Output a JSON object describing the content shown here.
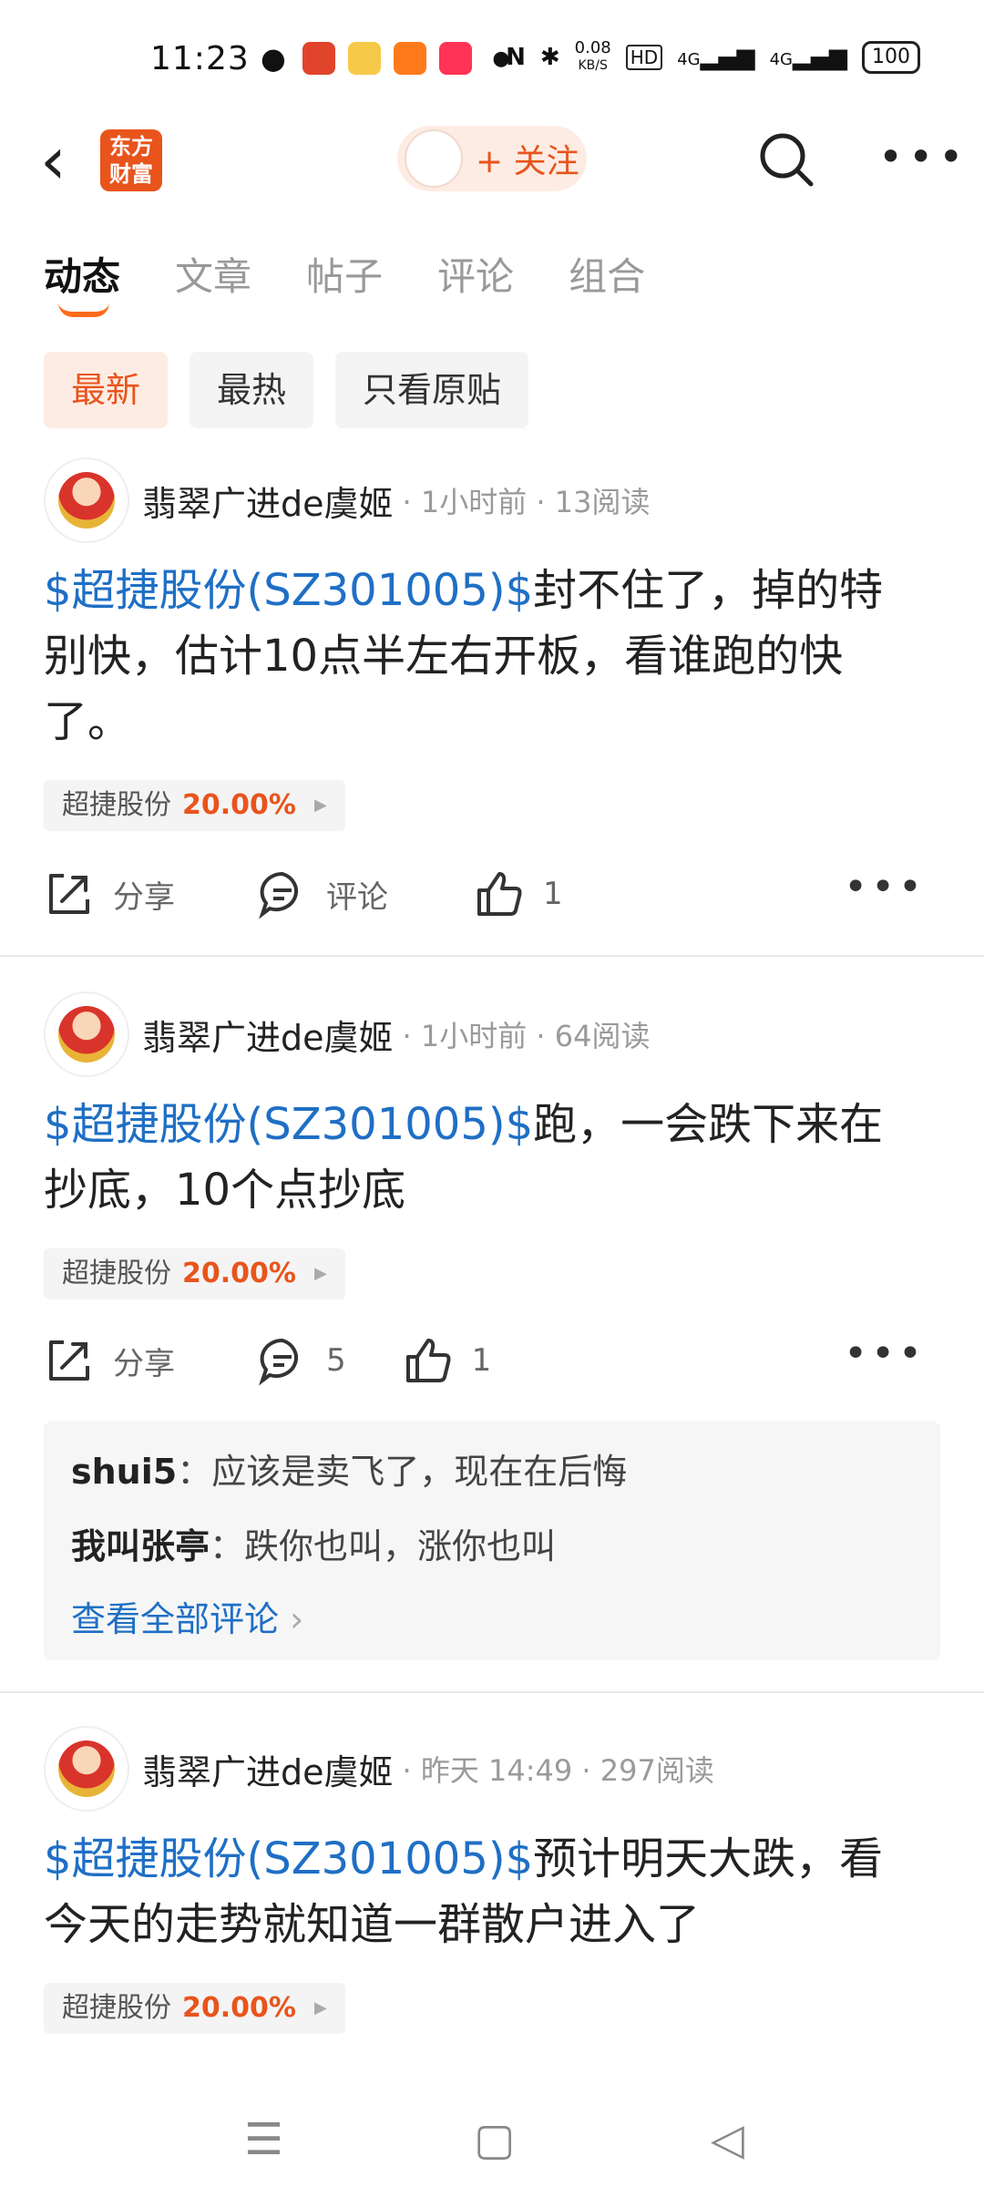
{
  "status_bar": {
    "time": "11:23",
    "net_speed": "0.08",
    "net_unit": "KB/S",
    "hd": "HD",
    "sig1": "4G",
    "sig2": "4G",
    "battery": "100"
  },
  "nav": {
    "app_logo_top": "东方",
    "app_logo_bottom": "财富",
    "follow_label": "+ 关注"
  },
  "tabs": [
    "动态",
    "文章",
    "帖子",
    "评论",
    "组合"
  ],
  "filters": [
    "最新",
    "最热",
    "只看原贴"
  ],
  "posts": [
    {
      "author": "翡翠广进de虞姬",
      "meta": "· 1小时前 · 13阅读",
      "tag": "$超捷股份(SZ301005)$",
      "text": "封不住了，掉的特别快，估计10点半左右开板，看谁跑的快了。",
      "stock_name": "超捷股份",
      "stock_change": "20.00%",
      "share_label": "分享",
      "comment_label": "评论",
      "like_count": "1"
    },
    {
      "author": "翡翠广进de虞姬",
      "meta": "· 1小时前 · 64阅读",
      "tag": "$超捷股份(SZ301005)$",
      "text": "跑，一会跌下来在抄底，10个点抄底",
      "stock_name": "超捷股份",
      "stock_change": "20.00%",
      "share_label": "分享",
      "comment_label": "5",
      "like_count": "1",
      "comments": [
        {
          "user": "shui5",
          "text": "应该是卖飞了，现在在后悔"
        },
        {
          "user": "我叫张亭",
          "text": "跌你也叫，涨你也叫"
        }
      ],
      "see_all": "查看全部评论"
    },
    {
      "author": "翡翠广进de虞姬",
      "meta": "· 昨天 14:49 · 297阅读",
      "tag": "$超捷股份(SZ301005)$",
      "text": "预计明天大跌，看今天的走势就知道一群散户进入了",
      "stock_name": "超捷股份",
      "stock_change": "20.00%"
    }
  ],
  "colors": {
    "accent": "#e8541c",
    "link": "#1f6fc5"
  }
}
